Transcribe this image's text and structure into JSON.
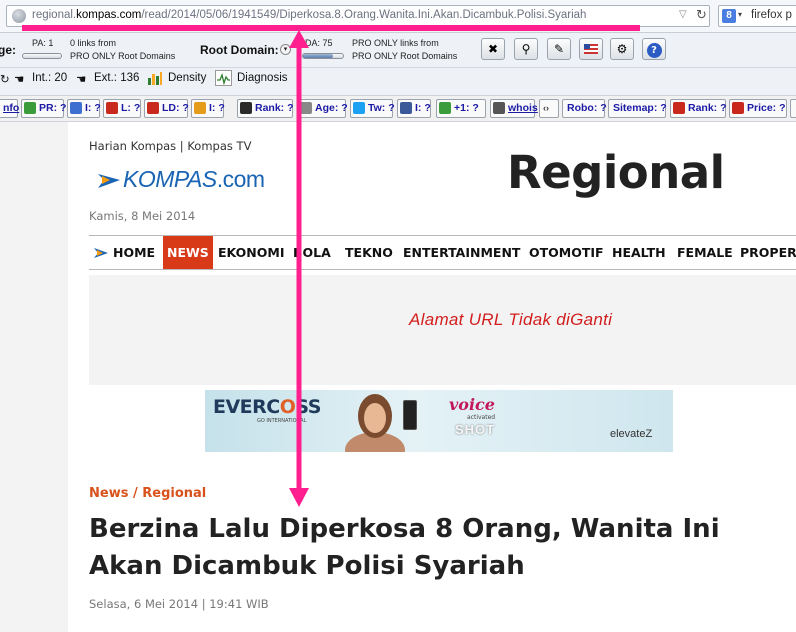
{
  "browser": {
    "url_prefix": "regional.",
    "url_domain": "kompas.com",
    "url_path": "/read/2014/05/06/1941549/Diperkosa.8.Orang.Wanita.Ini.Akan.Dicambuk.Polisi.Syariah",
    "search_text": "firefox p",
    "search_engine_icon": "8"
  },
  "seo_toolbar": {
    "page_label": "ge:",
    "pa_label": "PA: 1",
    "pa_value": 0.0,
    "pa_links": "0 links from",
    "pa_root": "PRO ONLY Root Domains",
    "root_domain_label": "Root Domain:",
    "da_label": "DA: 75",
    "da_value": 0.75,
    "da_links": "PRO ONLY links from",
    "da_root": "PRO ONLY Root Domains",
    "tool_icons": [
      "tools-icon",
      "magnifier-icon",
      "pencil-icon",
      "flag-icon",
      "gears-icon",
      "help-icon"
    ],
    "int_label": "Int.: 20",
    "ext_label": "Ext.: 136",
    "density_label": "Density",
    "diagnosis_label": "Diagnosis"
  },
  "seoquake": {
    "items": [
      {
        "label": "nfo",
        "color": "#4a7de0"
      },
      {
        "label": "PR: ?",
        "color": "#3b9c3b"
      },
      {
        "label": "I: ?",
        "color": "#3d6fd1"
      },
      {
        "label": "L: ?",
        "color": "#c9281c"
      },
      {
        "label": "LD: ?",
        "color": "#c9281c"
      },
      {
        "label": "I: ?",
        "color": "#e59c1b"
      },
      {
        "label": "Rank: ?",
        "color": "#2a2a2a"
      },
      {
        "label": "Age: ?",
        "color": "#888888"
      },
      {
        "label": "Tw: ?",
        "color": "#1da1f2"
      },
      {
        "label": "I: ?",
        "color": "#3b5998"
      },
      {
        "label": "+1: ?",
        "color": "#3a9c3a"
      },
      {
        "label": "whois",
        "color": "#555555"
      },
      {
        "label": "",
        "color": "#777777"
      },
      {
        "label": "Robo: ?",
        "color": "#aaaaaa"
      },
      {
        "label": "Sitemap: ?",
        "color": "#aaaaaa"
      },
      {
        "label": "Rank: ?",
        "color": "#c9281c"
      },
      {
        "label": "Price: ?",
        "color": "#c9281c"
      }
    ]
  },
  "site": {
    "top_links": "Harian Kompas | Kompas TV",
    "logo_main": "KOMPAS",
    "logo_com": ".com",
    "date": "Kamis, 8 Mei 2014",
    "section_title": "Regional",
    "nav": [
      "HOME",
      "NEWS",
      "EKONOMI",
      "BOLA",
      "TEKNO",
      "ENTERTAINMENT",
      "OTOMOTIF",
      "HEALTH",
      "FEMALE",
      "PROPERTI"
    ],
    "active_nav": "NEWS",
    "ad_note": "Alamat URL Tidak diGanti",
    "banner": {
      "brand_a": "EVERC",
      "brand_o": "O",
      "brand_b": "SS",
      "brand_sub": "GO INTERNATIONAL",
      "voice": "voice",
      "activated": "activated",
      "shot": "SHOT",
      "elevatez": "elevateZ"
    },
    "breadcrumb": "News / Regional",
    "headline": "Berzina Lalu Diperkosa 8 Orang, Wanita Ini Akan Dicambuk Polisi Syariah",
    "article_date": "Selasa, 6 Mei 2014 | 19:41 WIB"
  },
  "colors": {
    "annotation": "#ff1f8f",
    "nav_active": "#d83a17",
    "breadcrumb": "#d8521c",
    "ad_note": "#d21e1e",
    "logo": "#1a64b4"
  }
}
